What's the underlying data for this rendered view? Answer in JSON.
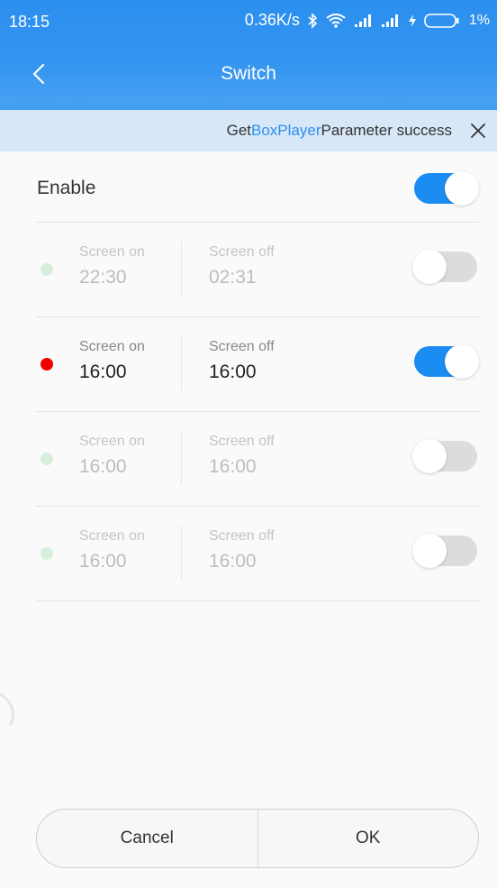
{
  "status_bar": {
    "time": "18:15",
    "speed": "0.36K/s",
    "battery_percent": "1%",
    "icons": [
      "bluetooth-icon",
      "wifi-icon",
      "signal-icon",
      "signal-icon",
      "charging-icon",
      "battery-icon"
    ]
  },
  "nav": {
    "title": "Switch",
    "back_icon": "chevron-left-icon"
  },
  "toast": {
    "prefix": "Get",
    "highlight": "BoxPlayer",
    "suffix": "Parameter success",
    "close_icon": "close-icon"
  },
  "enable": {
    "label": "Enable",
    "on": true
  },
  "schedules": [
    {
      "on_label": "Screen on",
      "on_time": "22:30",
      "off_label": "Screen off",
      "off_time": "02:31",
      "enabled": false,
      "dot_color": "#d6eedb"
    },
    {
      "on_label": "Screen on",
      "on_time": "16:00",
      "off_label": "Screen off",
      "off_time": "16:00",
      "enabled": true,
      "dot_color": "#f00000"
    },
    {
      "on_label": "Screen on",
      "on_time": "16:00",
      "off_label": "Screen off",
      "off_time": "16:00",
      "enabled": false,
      "dot_color": "#d6eedb"
    },
    {
      "on_label": "Screen on",
      "on_time": "16:00",
      "off_label": "Screen off",
      "off_time": "16:00",
      "enabled": false,
      "dot_color": "#d6eedb"
    }
  ],
  "buttons": {
    "cancel": "Cancel",
    "ok": "OK"
  },
  "colors": {
    "accent": "#1b8cf2",
    "header": "#2b8fef",
    "toast_bg": "#d8e7f7",
    "highlight_text": "#2a8ff0"
  }
}
